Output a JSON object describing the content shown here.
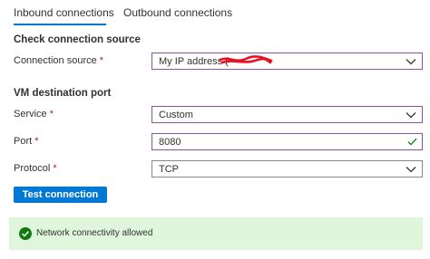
{
  "tabs": {
    "inbound": "Inbound connections",
    "outbound": "Outbound connections"
  },
  "check_source": {
    "heading": "Check connection source",
    "connection_source": {
      "label": "Connection source",
      "required_mark": "*",
      "value": "My IP address ("
    }
  },
  "destination": {
    "heading": "VM destination port",
    "service": {
      "label": "Service",
      "required_mark": "*",
      "value": "Custom"
    },
    "port": {
      "label": "Port",
      "required_mark": "*",
      "value": "8080"
    },
    "protocol": {
      "label": "Protocol",
      "required_mark": "*",
      "value": "TCP"
    }
  },
  "actions": {
    "test_label": "Test connection"
  },
  "result": {
    "message": "Network connectivity allowed"
  },
  "colors": {
    "accent": "#0078d4",
    "required": "#a4262c",
    "success": "#107c10",
    "success_bg": "#dff6dd",
    "focus_border": "#8a54a2",
    "redaction": "#e81123"
  }
}
